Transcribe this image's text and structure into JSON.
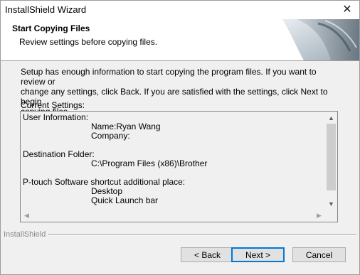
{
  "window": {
    "title": "InstallShield Wizard"
  },
  "header": {
    "title": "Start Copying Files",
    "subtitle": "Review settings before copying files."
  },
  "description": {
    "line1": "Setup has enough information to start copying the program files.  If you want to review or",
    "line2": "change any settings, click Back.  If you are satisfied with the settings, click Next to begin",
    "line3": "copying files."
  },
  "current_settings_label": "Current Settings:",
  "settings": {
    "user_info_label": "User Information:",
    "name_line": "Name:Ryan Wang",
    "company_line": "Company:",
    "dest_label": "Destination Folder:",
    "dest_path": "C:\\Program Files (x86)\\Brother",
    "shortcut_label": "P-touch Software shortcut additional place:",
    "shortcut_desktop": "Desktop",
    "shortcut_quicklaunch": "Quick Launch bar"
  },
  "footer": {
    "brand": "InstallShield"
  },
  "buttons": {
    "back": "< Back",
    "next": "Next >",
    "cancel": "Cancel"
  },
  "icons": {
    "close": "close-icon",
    "scroll_up": "scroll-up-icon",
    "scroll_down": "scroll-down-icon",
    "scroll_left": "scroll-left-icon",
    "scroll_right": "scroll-right-icon"
  },
  "colors": {
    "default_button_border": "#0078d7",
    "panel": "#f0f0f0"
  }
}
